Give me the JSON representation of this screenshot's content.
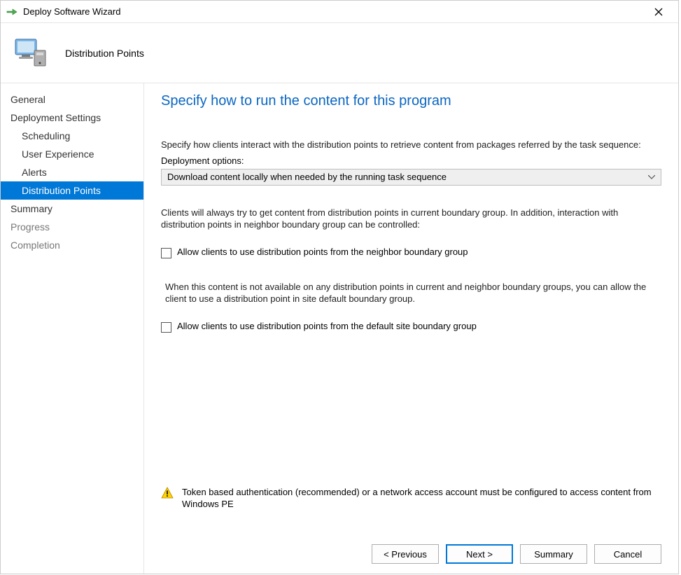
{
  "titlebar": {
    "title": "Deploy Software Wizard"
  },
  "header": {
    "page_title": "Distribution Points"
  },
  "sidebar": {
    "items": [
      {
        "label": "General",
        "indent": false,
        "selected": false,
        "disabled": false
      },
      {
        "label": "Deployment Settings",
        "indent": false,
        "selected": false,
        "disabled": false
      },
      {
        "label": "Scheduling",
        "indent": true,
        "selected": false,
        "disabled": false
      },
      {
        "label": "User Experience",
        "indent": true,
        "selected": false,
        "disabled": false
      },
      {
        "label": "Alerts",
        "indent": true,
        "selected": false,
        "disabled": false
      },
      {
        "label": "Distribution Points",
        "indent": true,
        "selected": true,
        "disabled": false
      },
      {
        "label": "Summary",
        "indent": false,
        "selected": false,
        "disabled": false
      },
      {
        "label": "Progress",
        "indent": false,
        "selected": false,
        "disabled": true
      },
      {
        "label": "Completion",
        "indent": false,
        "selected": false,
        "disabled": true
      }
    ]
  },
  "content": {
    "heading": "Specify how to run the content for this program",
    "intro": "Specify how clients interact with the distribution points to retrieve content from packages referred by the task sequence:",
    "deploy_options_label": "Deployment options:",
    "deploy_option_selected": "Download content locally when needed by the running task sequence",
    "boundary_text": "Clients will always try to get content from distribution points in current boundary group. In addition, interaction with distribution points in neighbor boundary group can be controlled:",
    "cb_neighbor_label": "Allow clients to use distribution points from the neighbor boundary group",
    "fallback_text": "When this content is not available on any distribution points in current and neighbor boundary groups, you can allow the client to use a distribution point in site default boundary group.",
    "cb_default_label": "Allow clients to use distribution points from the default site boundary group",
    "warning_text": "Token based authentication (recommended) or a network access account must be configured to access content from Windows PE"
  },
  "buttons": {
    "previous": "< Previous",
    "next": "Next >",
    "summary": "Summary",
    "cancel": "Cancel"
  }
}
